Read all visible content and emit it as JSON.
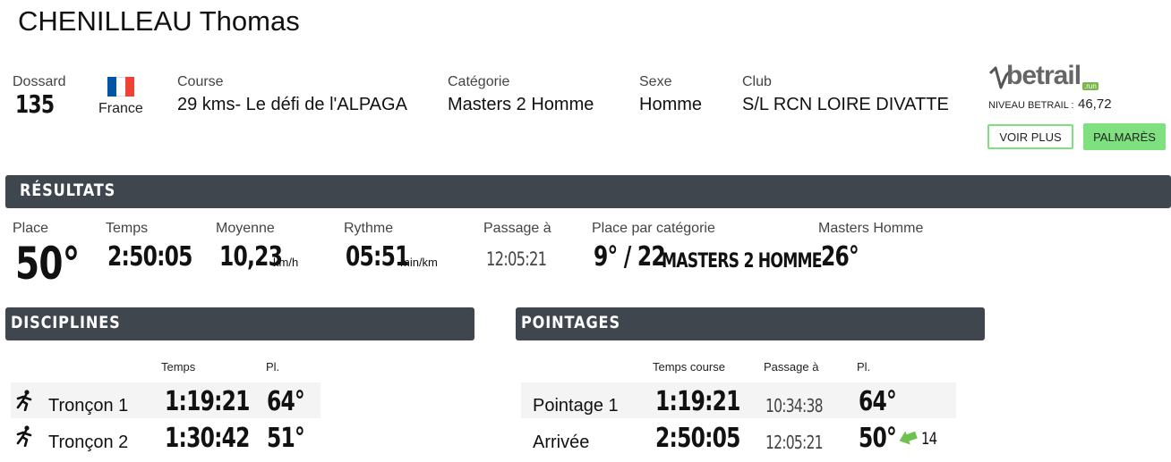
{
  "athlete": {
    "name": "CHENILLEAU Thomas"
  },
  "info": {
    "bib_label": "Dossard",
    "bib_value": "135",
    "country": "France",
    "course_label": "Course",
    "course_value": "29 kms- Le défi de l'ALPAGA",
    "category_label": "Catégorie",
    "category_value": "Masters 2 Homme",
    "sex_label": "Sexe",
    "sex_value": "Homme",
    "club_label": "Club",
    "club_value": "S/L RCN LOIRE DIVATTE"
  },
  "betrail": {
    "logo_text": "betrail",
    "logo_sub": ".run",
    "level_label": "NIVEAU BETRAIL :",
    "level_value": "46,72",
    "more_button": "VOIR PLUS",
    "palmares_button": "PALMARÈS"
  },
  "results": {
    "title": "RÉSULTATS",
    "place_label": "Place",
    "place_value": "50°",
    "time_label": "Temps",
    "time_value": "2:50:05",
    "avg_label": "Moyenne",
    "avg_value": "10,23",
    "avg_unit": "km/h",
    "pace_label": "Rythme",
    "pace_value": "05:51",
    "pace_unit": "min/km",
    "passage_label": "Passage à",
    "passage_value": "12:05:21",
    "cat_place_label": "Place par catégorie",
    "cat_place_value": "9° / 22",
    "cat_place_cat": "MASTERS 2 HOMME",
    "masters_label": "Masters Homme",
    "masters_value": "26°"
  },
  "disciplines": {
    "title": "DISCIPLINES",
    "col_time": "Temps",
    "col_place": "Pl.",
    "rows": [
      {
        "icon": "runner-icon",
        "name": "Tronçon 1",
        "time": "1:19:21",
        "place": "64°"
      },
      {
        "icon": "runner-icon",
        "name": "Tronçon 2",
        "time": "1:30:42",
        "place": "51°"
      }
    ]
  },
  "pointages": {
    "title": "POINTAGES",
    "col_time": "Temps course",
    "col_passage": "Passage à",
    "col_place": "Pl.",
    "rows": [
      {
        "name": "Pointage 1",
        "time": "1:19:21",
        "passage": "10:34:38",
        "place": "64°"
      },
      {
        "name": "Arrivée",
        "time": "2:50:05",
        "passage": "12:05:21",
        "place": "50°",
        "gain": "14",
        "gain_icon": "arrow-up-icon"
      }
    ]
  },
  "colors": {
    "bar": "#3f464e",
    "green": "#7ee07e",
    "green_border": "#6bc96b",
    "gain_green": "#6cc24a",
    "flag_blue": "#0055a4",
    "flag_red": "#ef4135"
  }
}
